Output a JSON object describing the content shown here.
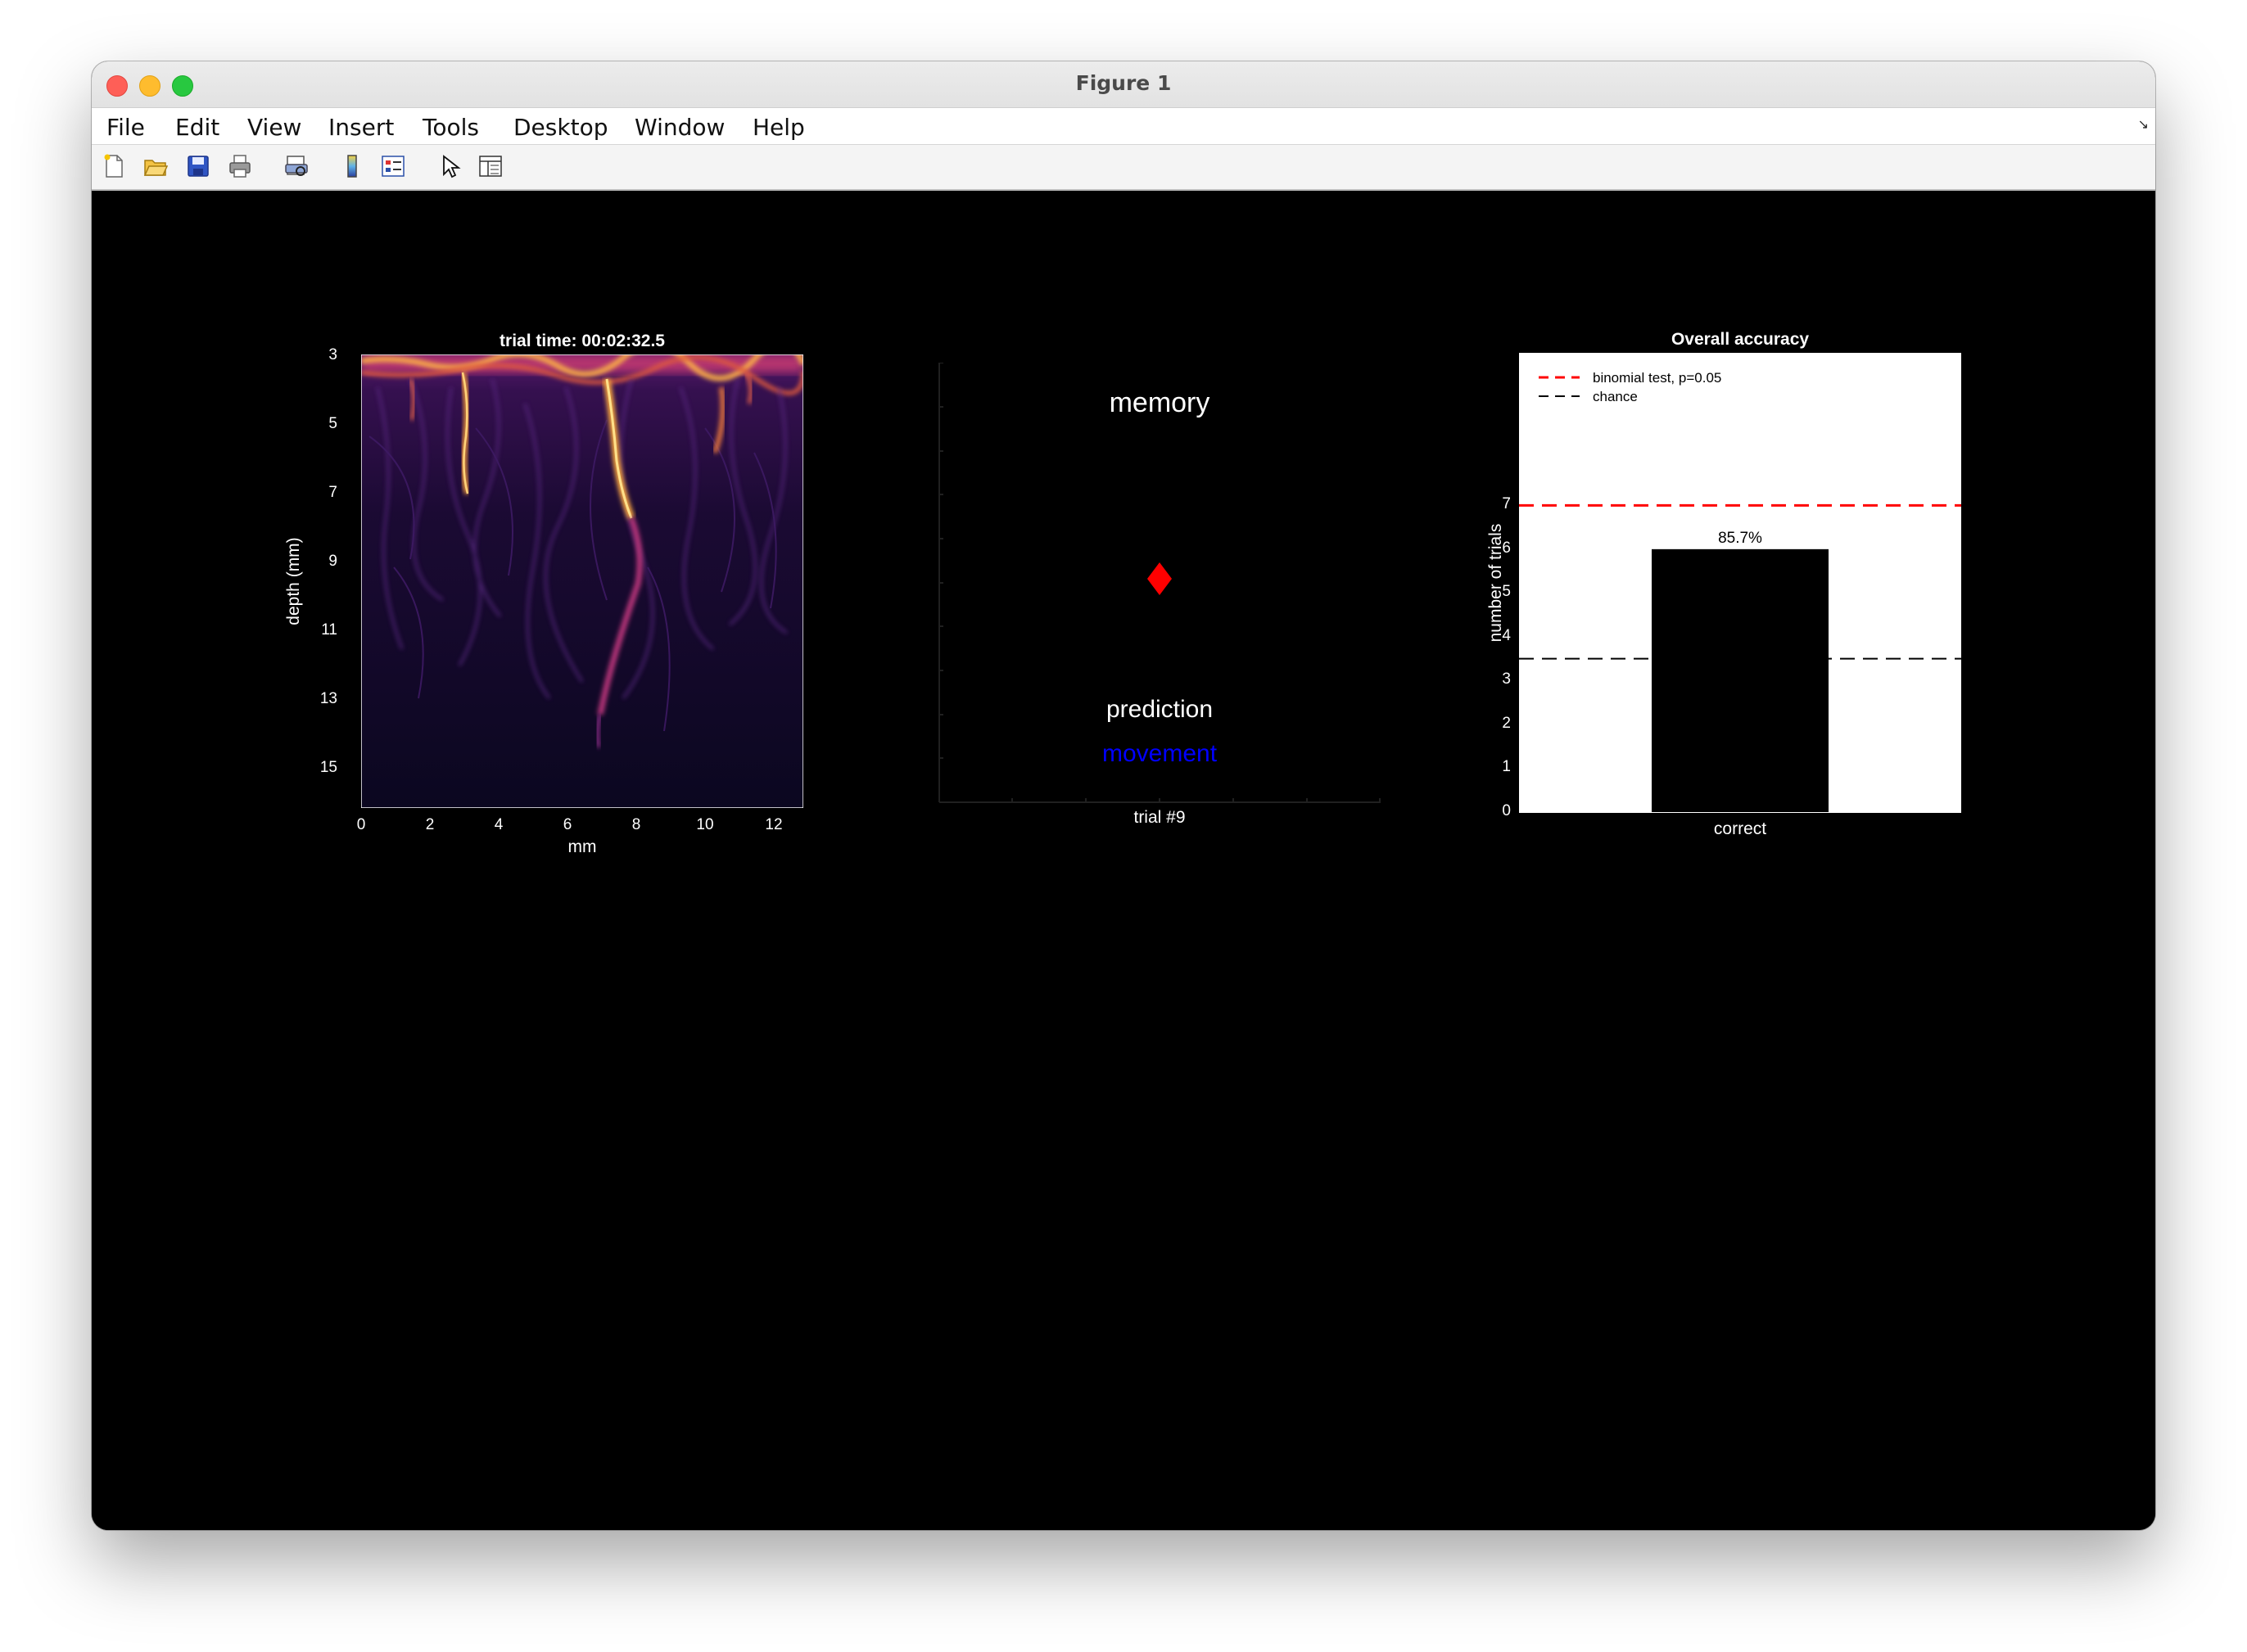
{
  "window": {
    "title": "Figure 1",
    "menu": [
      "File",
      "Edit",
      "View",
      "Insert",
      "Tools",
      "Desktop",
      "Window",
      "Help"
    ],
    "toolbar_icons": [
      "new-figure-icon",
      "open-file-icon",
      "save-icon",
      "print-icon",
      "print-preview-icon",
      "colorbar-icon",
      "legend-icon",
      "pointer-icon",
      "property-inspector-icon"
    ]
  },
  "colors": {
    "figure_bg": "#000000",
    "prediction_marker": "#ff0000",
    "movement_text": "#0000ff",
    "binomial_line": "#ff0000",
    "chance_line": "#000000",
    "bar": "#000000"
  },
  "image_plot": {
    "title": "trial time: 00:02:32.5",
    "xlabel": "mm",
    "ylabel": "depth (mm)",
    "xticks": [
      "0",
      "2",
      "4",
      "6",
      "8",
      "10",
      "12"
    ],
    "yticks": [
      "3",
      "5",
      "7",
      "9",
      "11",
      "13",
      "15"
    ],
    "colormap": "inferno"
  },
  "prediction_panel": {
    "top_label": "memory",
    "marker": "diamond",
    "prediction_label": "prediction",
    "class_label": "movement",
    "xlabel": "trial #9"
  },
  "chart_data": [
    {
      "type": "bar",
      "title": "Overall accuracy",
      "categories": [
        "correct"
      ],
      "values": [
        6
      ],
      "data_label": "85.7%",
      "ylabel": "number of trials",
      "ylim": [
        0,
        10.5
      ],
      "yticks": [
        "0",
        "1",
        "2",
        "3",
        "4",
        "5",
        "6",
        "7"
      ],
      "reference_lines": [
        {
          "name": "binomial test, p=0.05",
          "y": 7,
          "style": "dashed",
          "color": "#ff0000"
        },
        {
          "name": "chance",
          "y": 3.5,
          "style": "dashed",
          "color": "#000000"
        }
      ],
      "legend_position": "top-left",
      "grid": false
    }
  ]
}
